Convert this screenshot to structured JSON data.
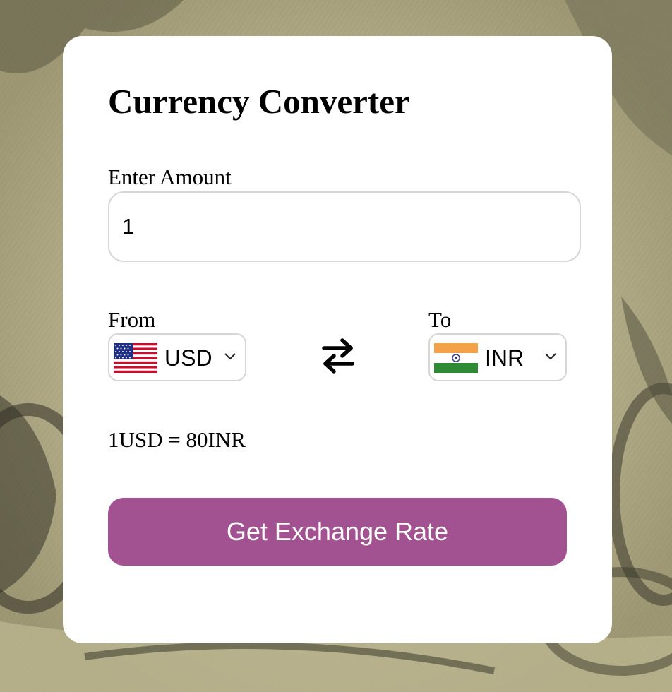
{
  "app": {
    "title": "Currency Converter"
  },
  "amount": {
    "label": "Enter Amount",
    "value": "1"
  },
  "from": {
    "label": "From",
    "currency": "USD",
    "flag_icon": "us-flag-icon"
  },
  "to": {
    "label": "To",
    "currency": "INR",
    "flag_icon": "india-flag-icon"
  },
  "swap": {
    "icon": "swap-arrows-icon"
  },
  "result": {
    "text": "1USD = 80INR"
  },
  "action": {
    "button_label": "Get Exchange Rate"
  },
  "colors": {
    "button_bg": "#a25191",
    "card_bg": "#ffffff",
    "border": "#d6d6d6"
  }
}
